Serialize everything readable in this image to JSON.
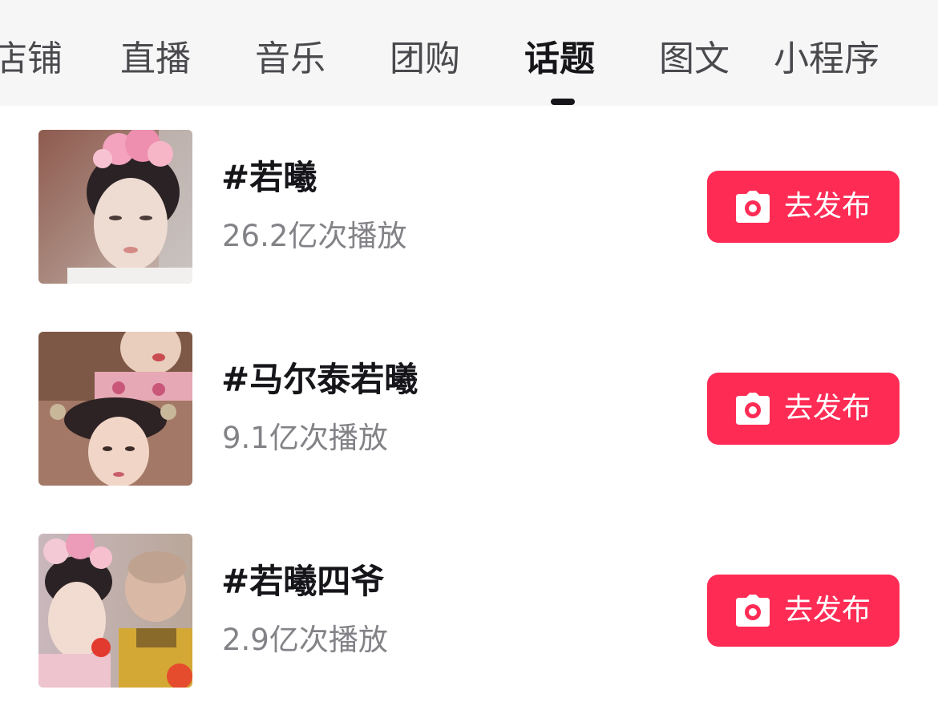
{
  "tabs": [
    {
      "label": "店铺",
      "active": false
    },
    {
      "label": "直播",
      "active": false
    },
    {
      "label": "音乐",
      "active": false
    },
    {
      "label": "团购",
      "active": false
    },
    {
      "label": "话题",
      "active": true
    },
    {
      "label": "图文",
      "active": false
    },
    {
      "label": "小程序",
      "active": false
    }
  ],
  "topics": [
    {
      "title": "#若曦",
      "plays": "26.2亿次播放",
      "button": "去发布"
    },
    {
      "title": "#马尔泰若曦",
      "plays": "9.1亿次播放",
      "button": "去发布"
    },
    {
      "title": "#若曦四爷",
      "plays": "2.9亿次播放",
      "button": "去发布"
    }
  ],
  "colors": {
    "accent": "#fe2c55",
    "tab_bg": "#f6f6f7",
    "text_primary": "#16161a",
    "text_secondary": "#828287"
  },
  "icons": {
    "publish": "camera-icon"
  }
}
